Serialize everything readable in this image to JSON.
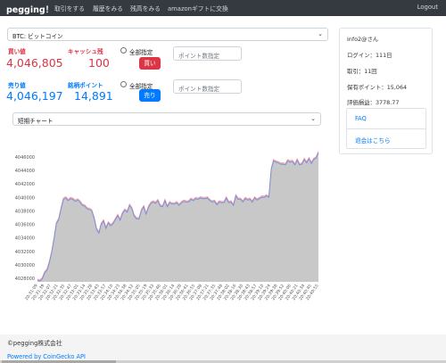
{
  "nav": {
    "brand": "pegging！",
    "links": [
      "取引をする",
      "履歴をみる",
      "残高をみる",
      "amazonギフトに交換"
    ],
    "logout": "Logout"
  },
  "coin_select": "BTC: ビットコイン",
  "buy": {
    "price_label": "買い値",
    "price": "4,046,805",
    "cash_label": "キャッシュ残",
    "cash": "100",
    "all_label": "全部指定",
    "button": "買い",
    "placeholder": "ポイント数指定"
  },
  "sell": {
    "price_label": "売り値",
    "price": "4,046,197",
    "points_label": "銘柄ポイント",
    "points": "14,891",
    "all_label": "全部指定",
    "button": "売り",
    "placeholder": "ポイント数指定"
  },
  "chart_select": "短期チャート",
  "user": {
    "name": "info2@さん",
    "login": "ログイン：111日",
    "trades": "取引：11回",
    "points": "保有ポイント：15,064",
    "valuation": "評価損益：3778.77"
  },
  "links": [
    "FAQ",
    "退会はこちら"
  ],
  "footer": {
    "copyright": "©pegging株式会社",
    "powered": "Powered by CoinGecko API"
  },
  "colors": {
    "buy": "#dc3545",
    "sell": "#007bff",
    "navbar": "#343a40"
  },
  "chart_data": {
    "type": "line",
    "series": [
      {
        "name": "",
        "color": "#ff9aa2",
        "values": [
          4027900,
          4027800,
          4028100,
          4029000,
          4029400,
          4030500,
          4032000,
          4034000,
          4036300,
          4036900,
          4038500,
          4039900,
          4040100,
          4039700,
          4040000,
          4039900,
          4039600,
          4039800,
          4039500,
          4039000,
          4038900,
          4038500,
          4038400,
          4038200,
          4037100,
          4035500,
          4034900,
          4036200,
          4036700,
          4035600,
          4036400,
          4036000,
          4036300,
          4036900,
          4037500,
          4036800,
          4037800,
          4038300,
          4038000,
          4039000,
          4038500,
          4037400,
          4037000,
          4037000,
          4038200,
          4038800,
          4037700,
          4038700,
          4039300,
          4039500,
          4039300,
          4039700,
          4038900,
          4038800,
          4039700,
          4038800,
          4039400,
          4039200,
          4039200,
          4039400,
          4039000,
          4039400,
          4039600,
          4039500,
          4039500,
          4039900,
          4039700,
          4040000,
          4039900,
          4040100,
          4040000,
          4040000,
          4040100,
          4039700,
          4039500,
          4039600,
          4039100,
          4039500,
          4039400,
          4039400,
          4040100,
          4039400,
          4039500,
          4039000,
          4040400,
          4039900,
          4039900,
          4039500,
          4040000,
          4039800,
          4039900,
          4039500,
          4040100,
          4039800,
          4040000,
          4040200,
          4040200,
          4040400,
          4040200,
          4044300,
          4045600,
          4045400,
          4045300,
          4045100,
          4045100,
          4045000,
          4045600,
          4045400,
          4045500,
          4045000,
          4045700,
          4045000,
          4045100,
          4045800,
          4045300,
          4045900,
          4045200,
          4045800,
          4046000,
          4046800
        ]
      },
      {
        "name": "",
        "color": "#6f8fe0",
        "values": [
          4027700,
          4027600,
          4027900,
          4028800,
          4029200,
          4030300,
          4031800,
          4033800,
          4036100,
          4036700,
          4038300,
          4039700,
          4039900,
          4039500,
          4039800,
          4039700,
          4039400,
          4039600,
          4039300,
          4038800,
          4038700,
          4038300,
          4038200,
          4038000,
          4036900,
          4035300,
          4034700,
          4036000,
          4036500,
          4035400,
          4036200,
          4035800,
          4036100,
          4036700,
          4037300,
          4036600,
          4037600,
          4038100,
          4037800,
          4038800,
          4038300,
          4037200,
          4036800,
          4036800,
          4038000,
          4038600,
          4037500,
          4038500,
          4039100,
          4039300,
          4039100,
          4039500,
          4038700,
          4038600,
          4039500,
          4038600,
          4039200,
          4039000,
          4039000,
          4039200,
          4038800,
          4039200,
          4039400,
          4039300,
          4039300,
          4039700,
          4039500,
          4039800,
          4039700,
          4039900,
          4039800,
          4039800,
          4039900,
          4039500,
          4039300,
          4039400,
          4038900,
          4039300,
          4039200,
          4039200,
          4039900,
          4039200,
          4039300,
          4038800,
          4040200,
          4039700,
          4039700,
          4039300,
          4039800,
          4039600,
          4039700,
          4039300,
          4039900,
          4039600,
          4039800,
          4040000,
          4040000,
          4040200,
          4040000,
          4044100,
          4045400,
          4045200,
          4045100,
          4044900,
          4044900,
          4044800,
          4045400,
          4045200,
          4045300,
          4044800,
          4045500,
          4044800,
          4044900,
          4045600,
          4045100,
          4045700,
          4045000,
          4045600,
          4045800,
          4046600
        ]
      }
    ],
    "fill": "#c8c8c8",
    "ylim": [
      4027500,
      4046500
    ],
    "yticks": [
      4028000,
      4030000,
      4032000,
      4034000,
      4036000,
      4038000,
      4040000,
      4042000,
      4044000,
      4046000
    ],
    "xticks": [
      "20:31:09",
      "20:31:39",
      "20:32:07",
      "20:32:21",
      "20:32:35",
      "20:32:47",
      "20:33:01",
      "20:33:14",
      "20:33:28",
      "20:33:43",
      "20:33:57",
      "20:34:10",
      "20:34:23",
      "20:34:38",
      "20:34:52",
      "20:35:05",
      "20:35:19",
      "20:35:33",
      "20:35:46",
      "20:36:01",
      "20:36:14",
      "20:36:28",
      "20:36:41",
      "20:36:55",
      "20:37:08",
      "20:37:21",
      "20:37:35",
      "20:37:48",
      "20:38:02",
      "20:38:16",
      "20:38:30",
      "20:38:43",
      "20:38:57",
      "20:39:10",
      "20:39:24",
      "20:39:38",
      "20:39:52",
      "20:40:06",
      "20:40:21",
      "20:40:34",
      "20:40:45",
      "20:40:55"
    ],
    "grid": false
  }
}
